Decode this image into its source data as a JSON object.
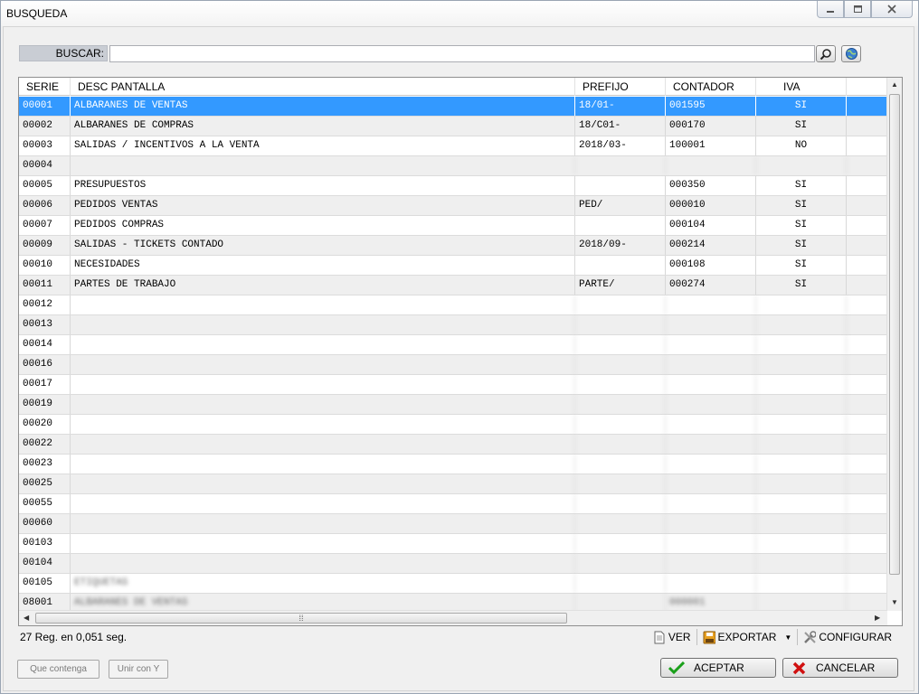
{
  "window": {
    "title": "BUSQUEDA"
  },
  "search": {
    "label": "BUSCAR:",
    "value": ""
  },
  "grid": {
    "columns": [
      "SERIE",
      "DESC PANTALLA",
      "PREFIJO",
      "CONTADOR",
      "IVA"
    ],
    "rows": [
      {
        "serie": "00001",
        "desc": "ALBARANES DE VENTAS",
        "prefijo": "18/01-",
        "contador": "001595",
        "iva": "SI",
        "selected": true
      },
      {
        "serie": "00002",
        "desc": "ALBARANES DE COMPRAS",
        "prefijo": "18/C01-",
        "contador": "000170",
        "iva": "SI"
      },
      {
        "serie": "00003",
        "desc": "SALIDAS / INCENTIVOS A LA VENTA",
        "prefijo": "2018/03-",
        "contador": "100001",
        "iva": "NO"
      },
      {
        "serie": "00004",
        "desc": "",
        "prefijo": "",
        "contador": "",
        "iva": "",
        "obscured": true
      },
      {
        "serie": "00005",
        "desc": "PRESUPUESTOS",
        "prefijo": "",
        "contador": "000350",
        "iva": "SI"
      },
      {
        "serie": "00006",
        "desc": "PEDIDOS VENTAS",
        "prefijo": "PED/",
        "contador": "000010",
        "iva": "SI"
      },
      {
        "serie": "00007",
        "desc": "PEDIDOS COMPRAS",
        "prefijo": "",
        "contador": "000104",
        "iva": "SI"
      },
      {
        "serie": "00009",
        "desc": "SALIDAS - TICKETS CONTADO",
        "prefijo": "2018/09-",
        "contador": "000214",
        "iva": "SI"
      },
      {
        "serie": "00010",
        "desc": "NECESIDADES",
        "prefijo": "",
        "contador": "000108",
        "iva": "SI"
      },
      {
        "serie": "00011",
        "desc": "PARTES DE TRABAJO",
        "prefijo": "PARTE/",
        "contador": "000274",
        "iva": "SI"
      },
      {
        "serie": "00012",
        "desc": "",
        "prefijo": "",
        "contador": "",
        "iva": "",
        "obscured": true
      },
      {
        "serie": "00013",
        "desc": "",
        "prefijo": "",
        "contador": "",
        "iva": "",
        "obscured": true
      },
      {
        "serie": "00014",
        "desc": "",
        "prefijo": "",
        "contador": "",
        "iva": "",
        "obscured": true
      },
      {
        "serie": "00016",
        "desc": "",
        "prefijo": "",
        "contador": "",
        "iva": "",
        "obscured": true
      },
      {
        "serie": "00017",
        "desc": "",
        "prefijo": "",
        "contador": "",
        "iva": "",
        "obscured": true
      },
      {
        "serie": "00019",
        "desc": "",
        "prefijo": "",
        "contador": "",
        "iva": "",
        "obscured": true
      },
      {
        "serie": "00020",
        "desc": "",
        "prefijo": "",
        "contador": "",
        "iva": "",
        "obscured": true
      },
      {
        "serie": "00022",
        "desc": "",
        "prefijo": "",
        "contador": "",
        "iva": "",
        "obscured": true
      },
      {
        "serie": "00023",
        "desc": "",
        "prefijo": "",
        "contador": "",
        "iva": "",
        "obscured": true
      },
      {
        "serie": "00025",
        "desc": "",
        "prefijo": "",
        "contador": "",
        "iva": "",
        "obscured": true
      },
      {
        "serie": "00055",
        "desc": "",
        "prefijo": "",
        "contador": "",
        "iva": "",
        "obscured": true
      },
      {
        "serie": "00060",
        "desc": "",
        "prefijo": "",
        "contador": "",
        "iva": "",
        "obscured": true
      },
      {
        "serie": "00103",
        "desc": "",
        "prefijo": "",
        "contador": "",
        "iva": "",
        "obscured": true
      },
      {
        "serie": "00104",
        "desc": "",
        "prefijo": "",
        "contador": "",
        "iva": "",
        "obscured": true
      },
      {
        "serie": "00105",
        "desc": "ETIQUETAS",
        "prefijo": "",
        "contador": "",
        "iva": "",
        "obscured": true
      },
      {
        "serie": "08001",
        "desc": "ALBARANES DE VENTAS",
        "prefijo": "",
        "contador": "000001",
        "iva": "",
        "obscured": true
      }
    ]
  },
  "status": {
    "text": "27 Reg. en 0,051 seg."
  },
  "toolbar": {
    "ver": "VER",
    "exportar": "EXPORTAR",
    "configurar": "CONFIGURAR"
  },
  "filters": {
    "contains": "Que contenga",
    "join": "Unir con Y"
  },
  "actions": {
    "accept": "ACEPTAR",
    "cancel": "CANCELAR"
  },
  "colors": {
    "selection": "#3399ff",
    "accept_icon": "#1aa01a",
    "cancel_icon": "#d01010"
  }
}
